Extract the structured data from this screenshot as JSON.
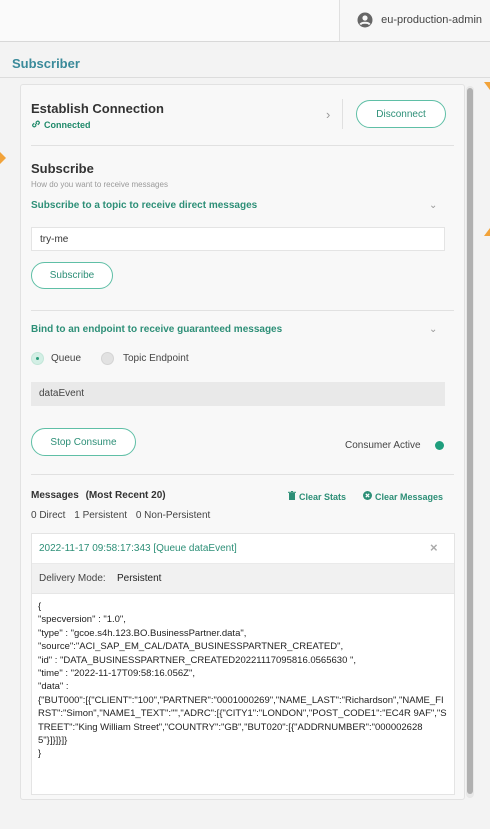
{
  "topbar": {
    "user_label": "eu-production-admin"
  },
  "page": {
    "section_title": "Subscriber"
  },
  "connection": {
    "title": "Establish Connection",
    "status": "Connected",
    "disconnect_label": "Disconnect"
  },
  "subscribe": {
    "title": "Subscribe",
    "subtitle": "How do you want to receive messages",
    "direct_label": "Subscribe to a topic to receive direct messages",
    "topic_value": "try-me",
    "button_label": "Subscribe"
  },
  "bind": {
    "label": "Bind to an endpoint to receive guaranteed messages",
    "option_queue": "Queue",
    "option_topic_endpoint": "Topic Endpoint",
    "selected": "Queue",
    "endpoint_value": "dataEvent",
    "stop_label": "Stop Consume",
    "consumer_status": "Consumer Active"
  },
  "messages": {
    "title": "Messages",
    "recent_label": "(Most Recent 20)",
    "clear_stats": "Clear Stats",
    "clear_messages": "Clear Messages",
    "counts": {
      "direct": "0 Direct",
      "persistent": "1 Persistent",
      "non_persistent": "0 Non-Persistent"
    },
    "item": {
      "header": "2022-11-17 09:58:17:343 [Queue dataEvent]",
      "delivery_label": "Delivery Mode:",
      "delivery_value": "Persistent",
      "body": "{\n\"specversion\" : \"1.0\",\n\"type\" : \"gcoe.s4h.123.BO.BusinessPartner.data\",\n\"source\":\"ACI_SAP_EM_CAL/DATA_BUSINESSPARTNER_CREATED\",\n\"id\" : \"DATA_BUSINESSPARTNER_CREATED20221117095816.0565630 \",\n\"time\" : \"2022-11-17T09:58:16.056Z\",\n\"data\" :\n{\"BUT000\":[{\"CLIENT\":\"100\",\"PARTNER\":\"0001000269\",\"NAME_LAST\":\"Richardson\",\"NAME_FIRST\":\"Simon\",\"NAME1_TEXT\":\"\",\"ADRC\":[{\"CITY1\":\"LONDON\",\"POST_CODE1\":\"EC4R 9AF\",\"STREET\":\"King William Street\",\"COUNTRY\":\"GB\",\"BUT020\":[{\"ADDRNUMBER\":\"0000026285\"}]}]}]}\n}"
    }
  },
  "colors": {
    "accent": "#2d8f77",
    "marker": "#f2a33a"
  }
}
